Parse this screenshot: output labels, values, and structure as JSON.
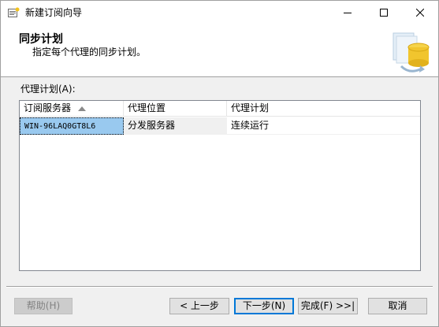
{
  "window": {
    "title": "新建订阅向导"
  },
  "header": {
    "title": "同步计划",
    "subtitle": "指定每个代理的同步计划。"
  },
  "section_label": "代理计划(A):",
  "grid": {
    "columns": [
      "订阅服务器",
      "代理位置",
      "代理计划"
    ],
    "rows": [
      {
        "subscriber": "WIN-96LAQ0GT8L6",
        "location": "分发服务器",
        "schedule": "连续运行"
      }
    ]
  },
  "buttons": {
    "help": "帮助(H)",
    "back": "< 上一步",
    "next": "下一步(N)",
    "finish": "完成(F) >>|",
    "cancel": "取消"
  },
  "colors": {
    "selected_cell": "#99c9ef",
    "default_button_border": "#0078d7"
  }
}
